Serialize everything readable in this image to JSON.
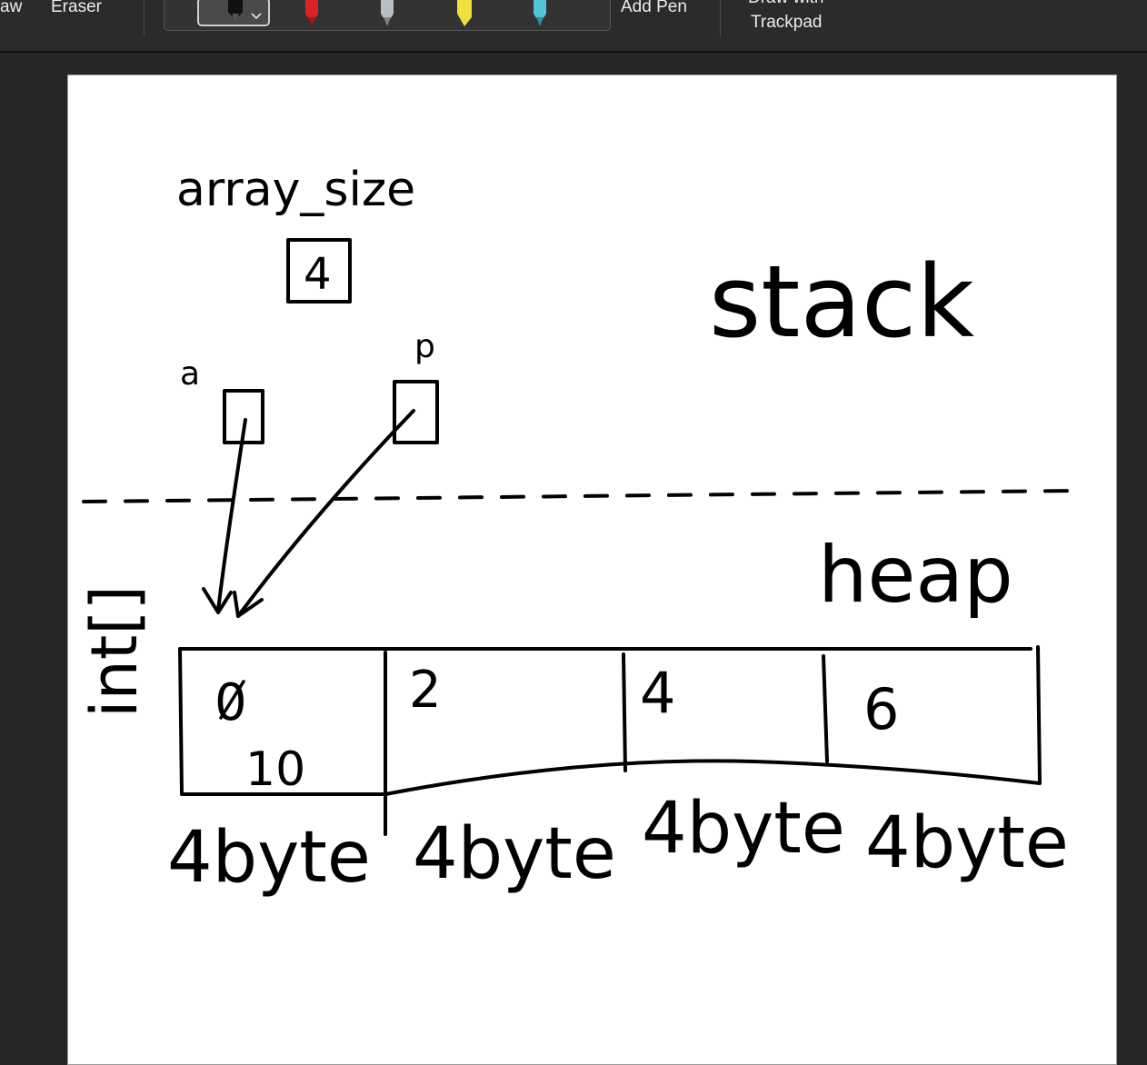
{
  "toolbar": {
    "draw_label": "aw",
    "eraser_label": "Eraser",
    "add_pen_label": "Add Pen",
    "trackpad_label_line1": "Draw with",
    "trackpad_label_line2": "Trackpad",
    "pens": [
      {
        "name": "black-pen",
        "color": "#111111",
        "selected": true
      },
      {
        "name": "red-pen",
        "color": "#e0242b",
        "selected": false
      },
      {
        "name": "gray-pencil",
        "color": "#9aa0a6",
        "selected": false
      },
      {
        "name": "yellow-highlighter",
        "color": "#f3e34a",
        "selected": false
      },
      {
        "name": "teal-highlighter",
        "color": "#4fc3d6",
        "selected": false
      }
    ]
  },
  "drawing": {
    "array_size_label": "array_size",
    "array_size_value": "4",
    "var_a_label": "a",
    "var_p_label": "p",
    "stack_label": "stack",
    "heap_label": "heap",
    "int_label": "int[]",
    "cells": [
      {
        "index": "0",
        "value": "10",
        "size": "4byte"
      },
      {
        "index": "2",
        "value": "",
        "size": "4byte"
      },
      {
        "index": "4",
        "value": "",
        "size": "4byte"
      },
      {
        "index": "6",
        "value": "",
        "size": "4byte"
      }
    ]
  }
}
